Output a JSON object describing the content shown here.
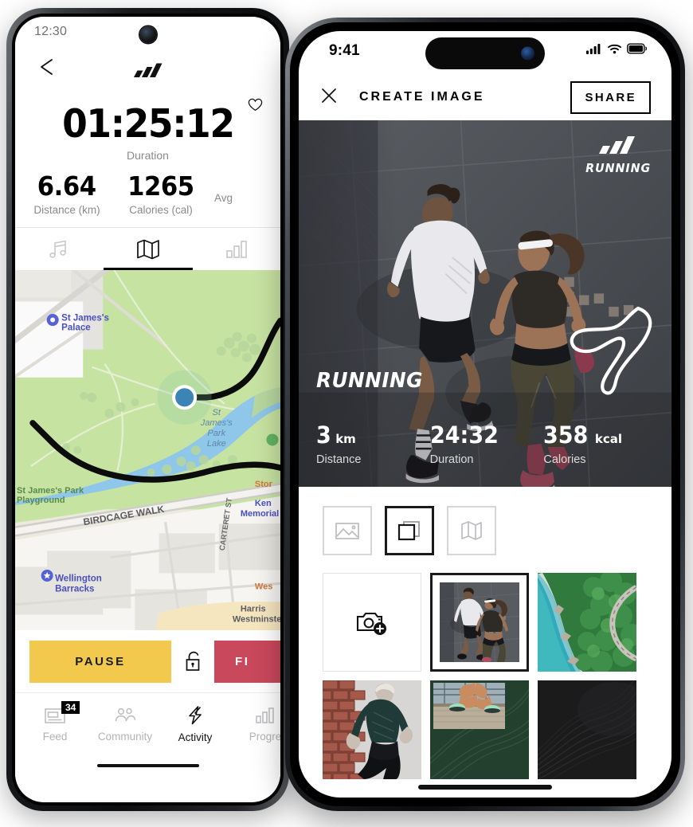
{
  "android": {
    "status_bar": {
      "time": "12:30"
    },
    "summary": {
      "duration": {
        "value": "01:25:12",
        "label": "Duration"
      },
      "stats": [
        {
          "value": "6.64",
          "label": "Distance (km)"
        },
        {
          "value": "1265",
          "label": "Calories (cal)"
        },
        {
          "value": "",
          "label": "Avg"
        }
      ]
    },
    "view_tabs": [
      {
        "icon": "music-icon",
        "active": false
      },
      {
        "icon": "map-icon",
        "active": true
      },
      {
        "icon": "stats-bar-icon",
        "active": false
      }
    ],
    "map": {
      "labels": [
        "St James's Palace",
        "St James's Park Lake",
        "St James's Park Playground",
        "BIRDCAGE WALK",
        "Wellington Barracks",
        "CARTERET ST",
        "Stor",
        "Ken Memorial",
        "Wes",
        "Harris Westminster"
      ]
    },
    "actions": {
      "pause_label": "PAUSE",
      "lock_icon": "unlocked-padlock-icon",
      "finish_label": "FI"
    },
    "bottom_nav": [
      {
        "label": "Feed",
        "icon": "feed-icon",
        "badge": "34",
        "active": false
      },
      {
        "label": "Community",
        "icon": "community-icon",
        "active": false
      },
      {
        "label": "Activity",
        "icon": "lightning-bolt-icon",
        "active": true
      },
      {
        "label": "Progre",
        "icon": "progress-bars-icon",
        "active": false
      }
    ]
  },
  "ios": {
    "status_bar": {
      "time": "9:41",
      "icons": [
        "cellular-signal-icon",
        "wifi-icon",
        "battery-icon"
      ]
    },
    "header": {
      "close_icon": "close-icon",
      "title": "CREATE IMAGE",
      "share_label": "SHARE"
    },
    "hero": {
      "badge_text": "RUNNING",
      "sport": "RUNNING",
      "stats": [
        {
          "value": "3",
          "unit": "km",
          "label": "Distance"
        },
        {
          "value": "24:32",
          "unit": "",
          "label": "Duration"
        },
        {
          "value": "358",
          "unit": "kcal",
          "label": "Calories"
        }
      ]
    },
    "templates": [
      {
        "icon": "image-icon",
        "selected": false
      },
      {
        "icon": "stacked-frames-icon",
        "selected": true
      },
      {
        "icon": "map-icon",
        "selected": false
      }
    ],
    "photo_grid": [
      {
        "type": "add-photo",
        "icon": "camera-add-icon",
        "selected": false
      },
      {
        "type": "photo",
        "name": "two-runners-pavement",
        "selected": true
      },
      {
        "type": "photo",
        "name": "aerial-coastal-road",
        "selected": false
      },
      {
        "type": "photo",
        "name": "runner-brick-wall",
        "selected": false
      },
      {
        "type": "template",
        "name": "green-steps-template",
        "selected": false
      },
      {
        "type": "template",
        "name": "dark-contour-template",
        "selected": false
      }
    ]
  },
  "colors": {
    "pause_yellow": "#F2C94C",
    "finish_red": "#C9485B",
    "accent_black": "#111111",
    "muted_text": "#8A8A8D",
    "map_park_green": "#C7E3A2",
    "map_water_blue": "#8EC7EA"
  }
}
